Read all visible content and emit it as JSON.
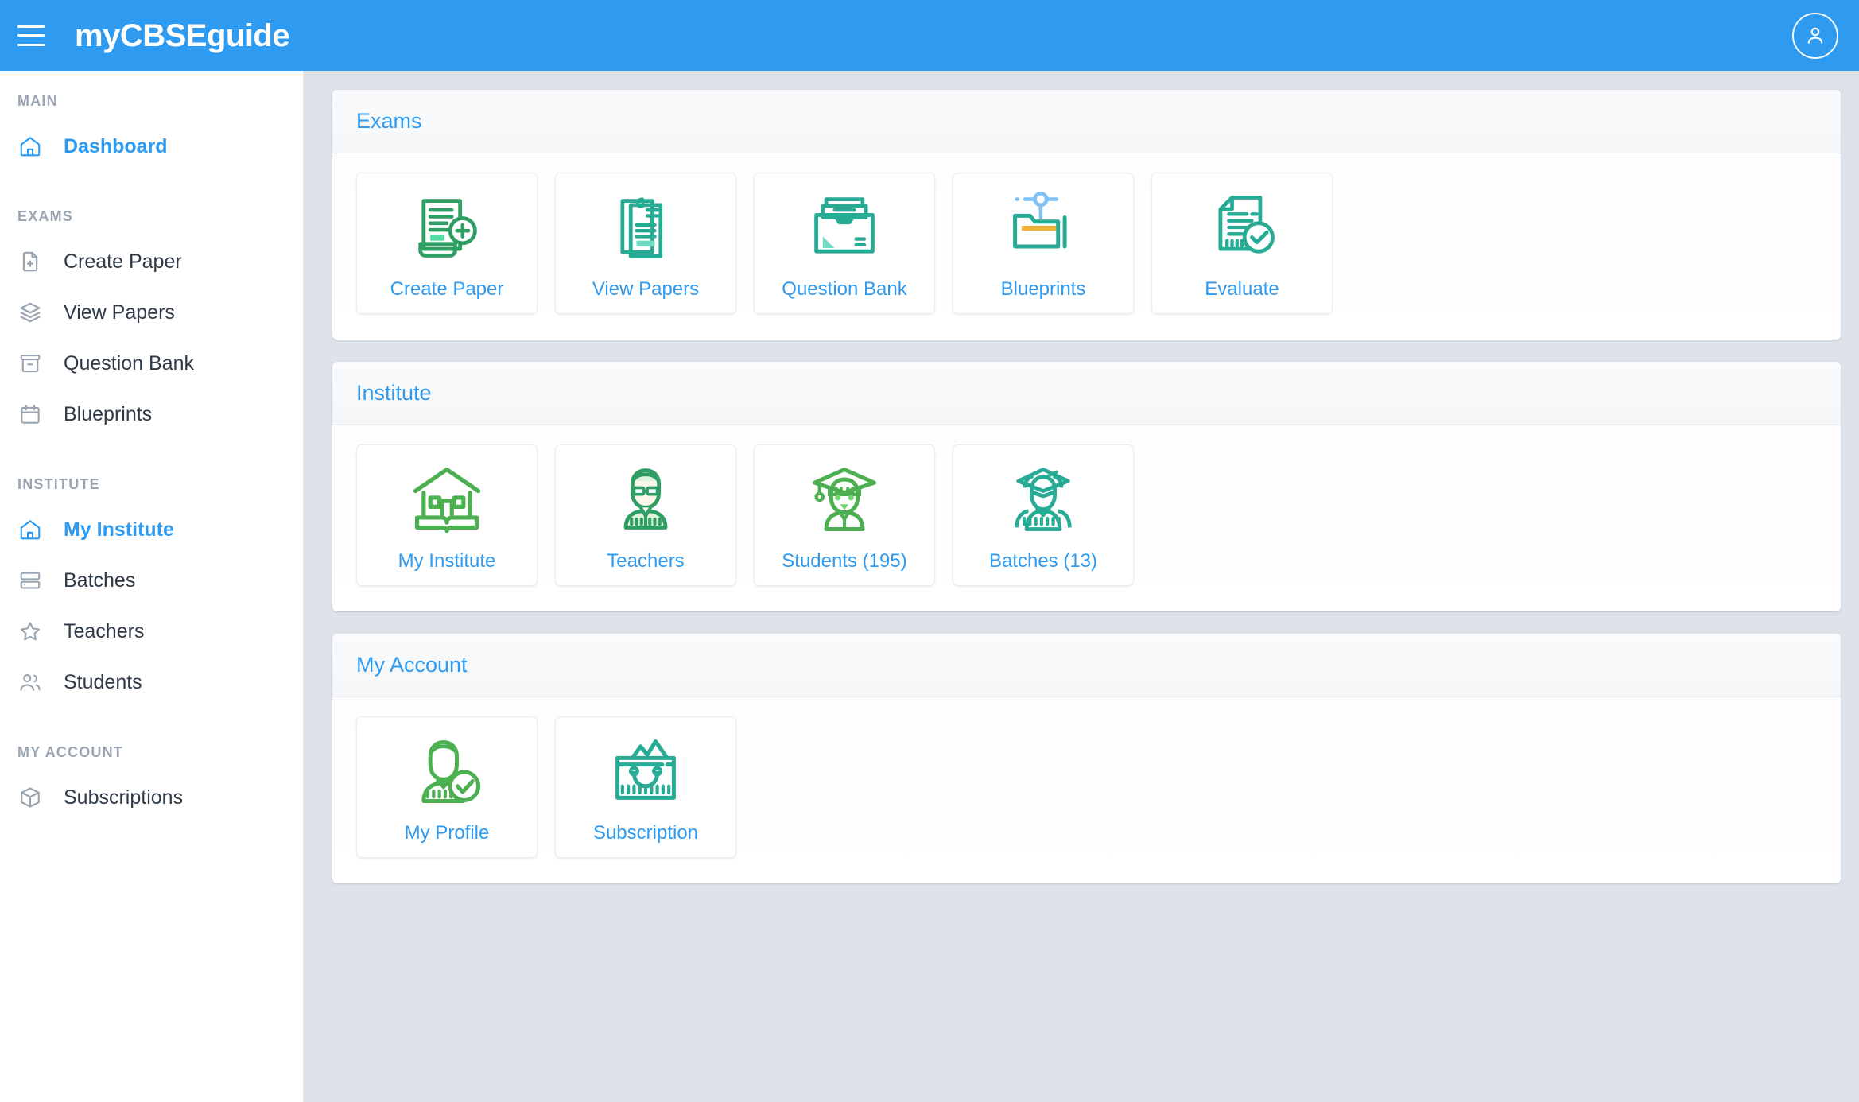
{
  "header": {
    "menu_icon": "hamburger-icon",
    "brand": "myCBSEguide",
    "avatar_icon": "user-circle-icon"
  },
  "sidebar": {
    "sections": [
      {
        "title": "MAIN",
        "items": [
          {
            "label": "Dashboard",
            "icon": "home-icon",
            "active": true
          }
        ]
      },
      {
        "title": "EXAMS",
        "items": [
          {
            "label": "Create Paper",
            "icon": "file-plus-icon",
            "active": false
          },
          {
            "label": "View Papers",
            "icon": "layers-icon",
            "active": false
          },
          {
            "label": "Question Bank",
            "icon": "archive-icon",
            "active": false
          },
          {
            "label": "Blueprints",
            "icon": "calendar-icon",
            "active": false
          }
        ]
      },
      {
        "title": "INSTITUTE",
        "items": [
          {
            "label": "My Institute",
            "icon": "home-icon",
            "active": true
          },
          {
            "label": "Batches",
            "icon": "server-icon",
            "active": false
          },
          {
            "label": "Teachers",
            "icon": "star-icon",
            "active": false
          },
          {
            "label": "Students",
            "icon": "users-icon",
            "active": false
          }
        ]
      },
      {
        "title": "MY ACCOUNT",
        "items": [
          {
            "label": "Subscriptions",
            "icon": "box-icon",
            "active": false
          }
        ]
      }
    ]
  },
  "main": {
    "panels": [
      {
        "title": "Exams",
        "tiles": [
          {
            "label": "Create Paper",
            "icon": "document-plus-icon"
          },
          {
            "label": "View Papers",
            "icon": "clipboard-pages-icon"
          },
          {
            "label": "Question Bank",
            "icon": "file-box-icon"
          },
          {
            "label": "Blueprints",
            "icon": "folder-node-icon"
          },
          {
            "label": "Evaluate",
            "icon": "document-check-icon"
          }
        ]
      },
      {
        "title": "Institute",
        "tiles": [
          {
            "label": "My Institute",
            "icon": "school-book-icon"
          },
          {
            "label": "Teachers",
            "icon": "teacher-icon"
          },
          {
            "label": "Students (195)",
            "icon": "graduate-student-icon"
          },
          {
            "label": "Batches (13)",
            "icon": "graduates-group-icon"
          }
        ]
      },
      {
        "title": "My Account",
        "tiles": [
          {
            "label": "My Profile",
            "icon": "profile-check-icon"
          },
          {
            "label": "Subscription",
            "icon": "shopping-bag-icon"
          }
        ]
      }
    ]
  },
  "colors": {
    "brand_blue": "#2e9bf0",
    "page_background": "#dde3e9",
    "teal": "#27ab94",
    "green": "#4caf50",
    "dark_green": "#2e9e63",
    "orange": "#f2b33d",
    "sidebar_text": "#2f3a47",
    "sidebar_muted": "#9aa5b1"
  }
}
